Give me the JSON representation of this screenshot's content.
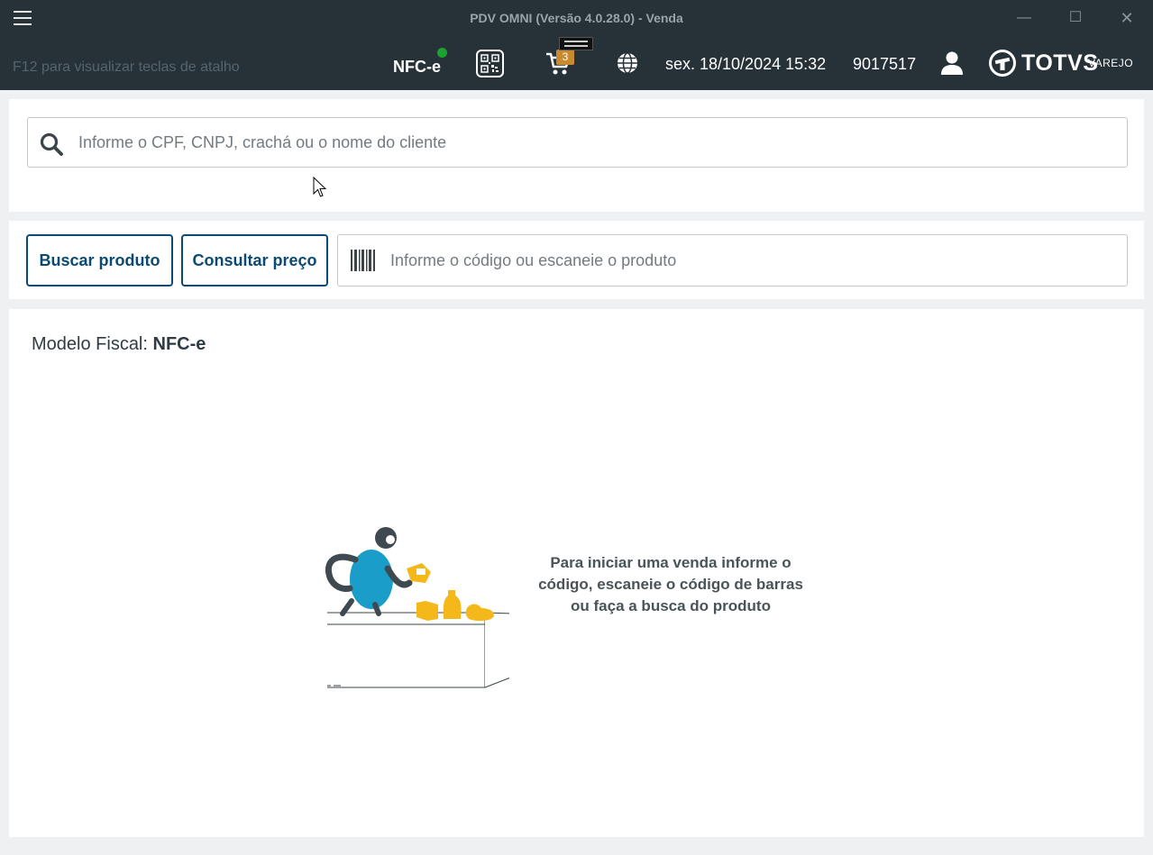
{
  "window": {
    "title": "PDV OMNI (Versão 4.0.28.0) - Venda",
    "minimize": "—",
    "maximize": "☐",
    "close": "✕"
  },
  "header": {
    "shortcut_hint": "F12 para visualizar teclas de atalho",
    "fiscal_mode": "NFC-e",
    "fiscal_status_color": "#1aa12f",
    "cart_count": "3",
    "datetime": "sex. 18/10/2024 15:32",
    "operator_id": "9017517",
    "logo_text": "TOTVS",
    "logo_sub": "VAREJO"
  },
  "client": {
    "search_placeholder": "Informe o CPF, CNPJ, crachá ou o nome do cliente"
  },
  "product": {
    "search_button": "Buscar produto",
    "price_button": "Consultar preço",
    "code_placeholder": "Informe o código ou escaneie o produto"
  },
  "main": {
    "fiscal_model_label": "Modelo Fiscal:",
    "fiscal_model_value": "NFC-e",
    "empty_message_lines": [
      "Para iniciar uma venda informe o",
      "código, escaneie o código de barras",
      "ou faça a busca do produto"
    ]
  },
  "colors": {
    "header_bg": "#263238",
    "brand_blue": "#0b4a72",
    "badge": "#c98a2e",
    "illustration_blue": "#1a9dc8",
    "illustration_yellow": "#f5b81b"
  },
  "icons": [
    "menu-icon",
    "qr-code-icon",
    "cart-icon",
    "globe-icon",
    "user-icon",
    "search-icon",
    "barcode-icon"
  ]
}
